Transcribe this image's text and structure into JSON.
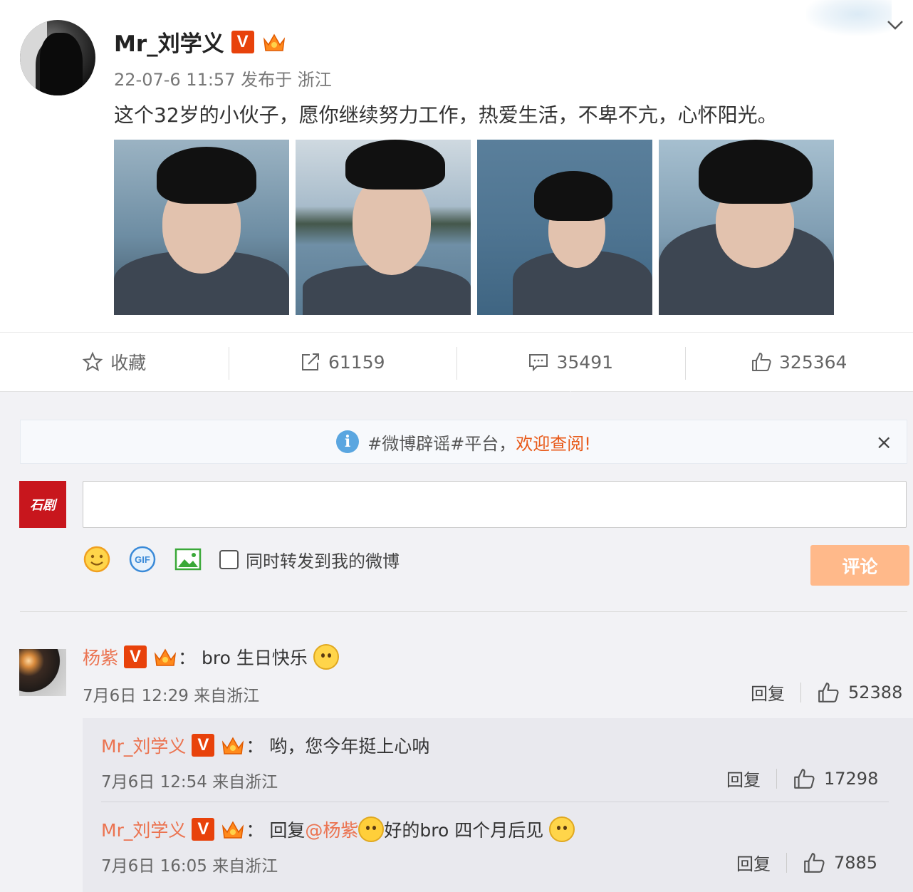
{
  "post": {
    "author": "Mr_刘学义",
    "verified_badge": "V",
    "meta": "22-07-6 11:57 发布于 浙江",
    "text": "这个32岁的小伙子，愿你继续努力工作，热爱生活，不卑不亢，心怀阳光。",
    "photo_count": 4
  },
  "actions": {
    "favorite_label": "收藏",
    "repost_count": "61159",
    "comment_count": "35491",
    "like_count": "325364"
  },
  "notice": {
    "text": "#微博辟谣#平台，",
    "link": "欢迎查阅!",
    "close": "×"
  },
  "composer": {
    "avatar_text": "石剧",
    "input_value": "",
    "repost_checkbox_label": "同时转发到我的微博",
    "submit_label": "评论"
  },
  "comments": [
    {
      "user": "杨紫",
      "badge": "V",
      "colon": "：",
      "text": "bro 生日快乐",
      "meta": "7月6日 12:29 来自浙江",
      "reply_label": "回复",
      "likes": "52388",
      "replies": [
        {
          "user": "Mr_刘学义",
          "badge": "V",
          "colon": "：",
          "text": "哟，您今年挺上心呐",
          "meta": "7月6日 12:54 来自浙江",
          "reply_label": "回复",
          "likes": "17298"
        },
        {
          "user": "Mr_刘学义",
          "badge": "V",
          "colon": "：",
          "text_prefix": "回复",
          "mention": "@杨紫",
          "text": "好的bro 四个月后见",
          "meta": "7月6日 16:05 来自浙江",
          "reply_label": "回复",
          "likes": "7885"
        }
      ]
    }
  ],
  "colors": {
    "accent_orange": "#eb7350",
    "verified_orange": "#e8420b",
    "submit_disabled": "#ffb98a",
    "panel_bg": "#f2f2f5",
    "info_blue": "#5aa6e0"
  },
  "icons": [
    "chevron-down-icon",
    "star-icon",
    "repost-icon",
    "comment-icon",
    "thumb-up-icon",
    "info-icon",
    "close-icon",
    "smiley-icon",
    "gif-icon",
    "image-icon",
    "crown-icon"
  ]
}
